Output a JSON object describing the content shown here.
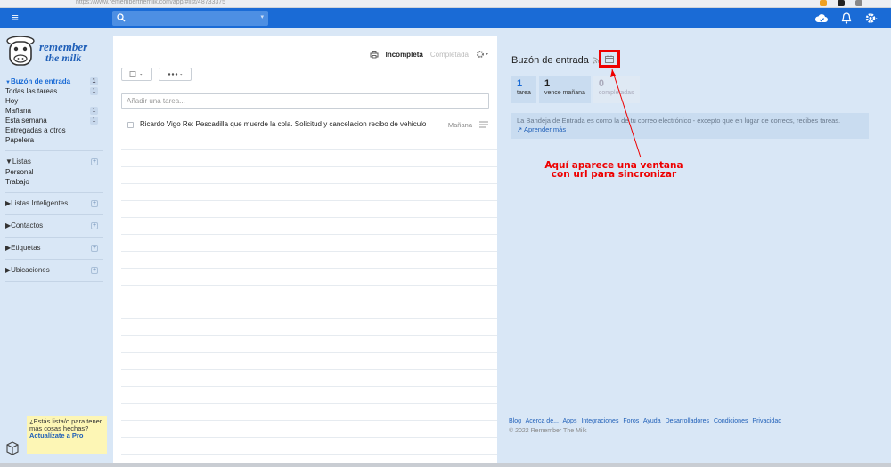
{
  "browser": {
    "url": "https://www.rememberthemilk.com/app/#list/48733375"
  },
  "brand": {
    "line1": "remember",
    "line2": "the milk"
  },
  "sidebar": {
    "items": [
      {
        "label": "Buzón de entrada",
        "count": "1",
        "active": true
      },
      {
        "label": "Todas las tareas",
        "count": "1"
      },
      {
        "label": "Hoy",
        "count": ""
      },
      {
        "label": "Mañana",
        "count": "1"
      },
      {
        "label": "Esta semana",
        "count": "1"
      },
      {
        "label": "Entregadas a otros",
        "count": ""
      },
      {
        "label": "Papelera",
        "count": ""
      }
    ],
    "lists_header": "Listas",
    "lists": [
      "Personal",
      "Trabajo"
    ],
    "groups": [
      "Listas Inteligentes",
      "Contactos",
      "Etiquetas",
      "Ubicaciones"
    ],
    "promo": {
      "text": "¿Estás lista/o para tener más cosas hechas?",
      "link": "Actualízate a Pro"
    }
  },
  "tasklist": {
    "tab_incomplete": "Incompleta",
    "tab_complete": "Completada",
    "add_placeholder": "Añadir una tarea...",
    "tasks": [
      {
        "text": "Ricardo Vigo Re: Pescadilla que muerde la cola. Solicitud y cancelacion recibo de vehiculo",
        "due": "Mañana"
      }
    ]
  },
  "detail": {
    "title": "Buzón de entrada",
    "stats": [
      {
        "n": "1",
        "label": "tarea"
      },
      {
        "n": "1",
        "label": "vence mañana"
      },
      {
        "n": "0",
        "label": "completadas"
      }
    ],
    "info": "La Bandeja de Entrada es como la de tu correo electrónico - excepto que en lugar de correos, recibes tareas.",
    "info_link": "Aprender más",
    "annotation_line1": "Aquí aparece una ventana",
    "annotation_line2": "con url para sincronizar",
    "footer_links": [
      "Blog",
      "Acerca de...",
      "Apps",
      "Integraciones",
      "Foros",
      "Ayuda",
      "Desarrolladores",
      "Condiciones",
      "Privacidad"
    ],
    "copyright": "© 2022 Remember The Milk"
  },
  "colors": {
    "accent": "#1a6bd6",
    "annotation": "#ee0000",
    "panel": "#d9e7f6"
  }
}
